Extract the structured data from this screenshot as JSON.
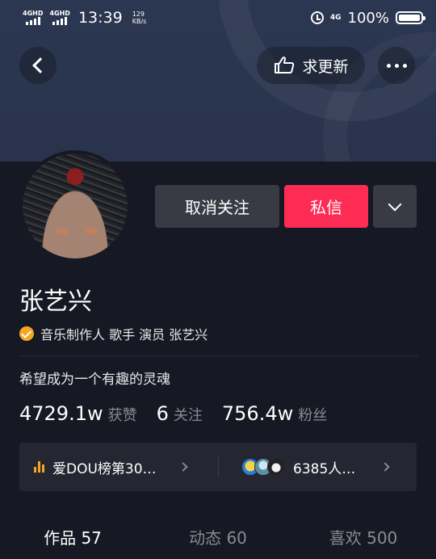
{
  "status_bar": {
    "signal1": "4GHD",
    "signal2": "4GHD",
    "time": "13:39",
    "speed_value": "129",
    "speed_unit": "KB/s",
    "network": "4G",
    "battery": "100%"
  },
  "header": {
    "update_label": "求更新"
  },
  "profile": {
    "name": "张艺兴",
    "verification": "音乐制作人 歌手 演员 张艺兴",
    "bio": "希望成为一个有趣的灵魂",
    "actions": {
      "unfollow_label": "取消关注",
      "message_label": "私信"
    },
    "stats": [
      {
        "value": "4729.1w",
        "label": "获赞"
      },
      {
        "value": "6",
        "label": "关注"
      },
      {
        "value": "756.4w",
        "label": "粉丝"
      }
    ],
    "rank_text": "爱DOU榜第30…",
    "fans_text": "6385人…"
  },
  "tabs": [
    {
      "label": "作品 57"
    },
    {
      "label": "动态 60"
    },
    {
      "label": "喜欢 500"
    }
  ],
  "colors": {
    "background": "#161823",
    "accent": "#fe2c55",
    "badge": "#f6a623"
  }
}
